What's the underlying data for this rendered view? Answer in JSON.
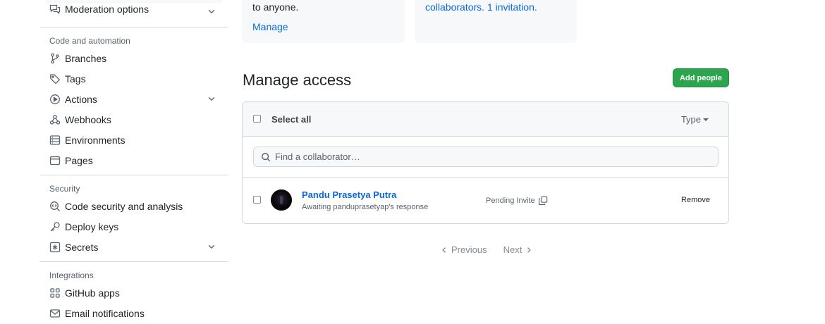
{
  "sidebar": {
    "top_item": {
      "label": "Moderation options",
      "icon": "comment-discussion-icon"
    },
    "sections": [
      {
        "heading": "Code and automation",
        "items": [
          {
            "label": "Branches",
            "icon": "git-branch-icon"
          },
          {
            "label": "Tags",
            "icon": "tag-icon"
          },
          {
            "label": "Actions",
            "icon": "play-icon",
            "expandable": true
          },
          {
            "label": "Webhooks",
            "icon": "webhook-icon"
          },
          {
            "label": "Environments",
            "icon": "server-icon"
          },
          {
            "label": "Pages",
            "icon": "browser-icon"
          }
        ]
      },
      {
        "heading": "Security",
        "items": [
          {
            "label": "Code security and analysis",
            "icon": "codescan-icon"
          },
          {
            "label": "Deploy keys",
            "icon": "key-icon"
          },
          {
            "label": "Secrets",
            "icon": "asterisk-icon",
            "expandable": true
          }
        ]
      },
      {
        "heading": "Integrations",
        "items": [
          {
            "label": "GitHub apps",
            "icon": "apps-icon"
          },
          {
            "label": "Email notifications",
            "icon": "mail-icon"
          }
        ]
      }
    ]
  },
  "cards": {
    "visibility": {
      "text": "to anyone.",
      "link": "Manage"
    },
    "access": {
      "link_collaborators": "collaborators",
      "separator": ". ",
      "link_invitation": "1 invitation",
      "suffix": "."
    }
  },
  "manage_access": {
    "title": "Manage access",
    "add_button": "Add people",
    "select_all": "Select all",
    "type_filter": "Type",
    "search_placeholder": "Find a collaborator…",
    "collaborators": [
      {
        "name": "Pandu Prasetya Putra",
        "subtitle": "Awaiting panduprasetyap's response",
        "status": "Pending Invite",
        "action": "Remove"
      }
    ]
  },
  "pagination": {
    "previous": "Previous",
    "next": "Next"
  },
  "colors": {
    "accent_link": "#0969da",
    "primary_button": "#2da44e",
    "muted_text": "#59636e",
    "border": "#d1d9e0",
    "subtle_bg": "#f6f8fa"
  }
}
